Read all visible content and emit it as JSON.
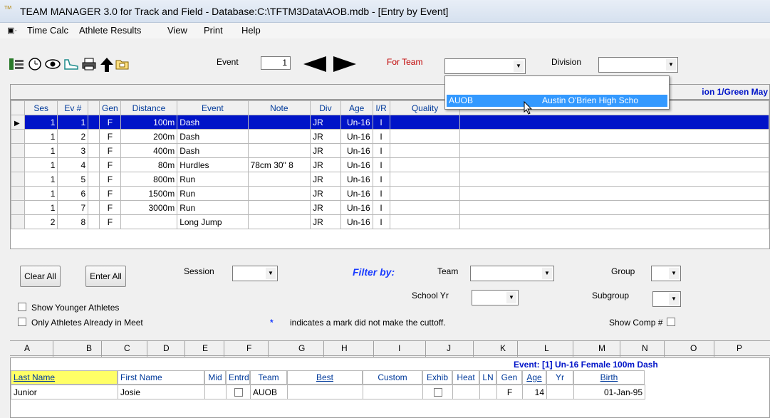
{
  "window": {
    "title": "TEAM MANAGER 3.0 for Track and Field - Database:C:\\TFTM3Data\\AOB.mdb - [Entry by Event]",
    "icon_text": "TM"
  },
  "menu": [
    "Time Calc",
    "Athlete Results",
    "View",
    "Print",
    "Help"
  ],
  "toolbar": {
    "event_label": "Event",
    "event_value": "1",
    "for_team_label": "For Team",
    "for_team_value": "",
    "division_label": "Division",
    "division_value": ""
  },
  "banner_text": "ion 1/Green May",
  "team_dropdown": {
    "code": "AUOB",
    "name": "Austin O'Brien High Scho"
  },
  "event_grid": {
    "headers": [
      "Ses",
      "Ev #",
      "Gen",
      "Distance",
      "Event",
      "Note",
      "Div",
      "Age",
      "I/R",
      "Quality"
    ],
    "rows": [
      [
        "1",
        "1",
        "F",
        "100m",
        "Dash",
        "",
        "JR",
        "Un-16",
        "I"
      ],
      [
        "1",
        "2",
        "F",
        "200m",
        "Dash",
        "",
        "JR",
        "Un-16",
        "I"
      ],
      [
        "1",
        "3",
        "F",
        "400m",
        "Dash",
        "",
        "JR",
        "Un-16",
        "I"
      ],
      [
        "1",
        "4",
        "F",
        "80m",
        "Hurdles",
        "78cm 30\" 8",
        "JR",
        "Un-16",
        "I"
      ],
      [
        "1",
        "5",
        "F",
        "800m",
        "Run",
        "",
        "JR",
        "Un-16",
        "I"
      ],
      [
        "1",
        "6",
        "F",
        "1500m",
        "Run",
        "",
        "JR",
        "Un-16",
        "I"
      ],
      [
        "1",
        "7",
        "F",
        "3000m",
        "Run",
        "",
        "JR",
        "Un-16",
        "I"
      ],
      [
        "2",
        "8",
        "F",
        "",
        "Long Jump",
        "",
        "JR",
        "Un-16",
        "I"
      ]
    ]
  },
  "filter": {
    "clear_all": "Clear All",
    "enter_all": "Enter All",
    "session_label": "Session",
    "filter_by": "Filter by:",
    "team_label": "Team",
    "school_yr_label": "School Yr",
    "group_label": "Group",
    "subgroup_label": "Subgroup",
    "show_younger": "Show Younger Athletes",
    "only_in_meet": "Only Athletes Already in Meet",
    "asterisk": "*",
    "note": "indicates a mark did not make the cuttoff.",
    "show_comp": "Show Comp #"
  },
  "column_letters": [
    "A",
    "B",
    "C",
    "D",
    "E",
    "F",
    "G",
    "H",
    "I",
    "J",
    "K",
    "L",
    "M",
    "N",
    "O",
    "P"
  ],
  "athlete_grid": {
    "event_header": "Event: [1]  Un-16  Female   100m  Dash",
    "headers": [
      "Last Name",
      "First Name",
      "Mid",
      "Entrd",
      "Team",
      "Best",
      "Custom",
      "Exhib",
      "Heat",
      "LN",
      "Gen",
      "Age",
      "Yr",
      "Birth"
    ],
    "rows": [
      {
        "last": "Junior",
        "first": "Josie",
        "mid": "",
        "team": "AUOB",
        "best": "",
        "custom": "",
        "heat": "",
        "ln": "",
        "gen": "F",
        "age": "14",
        "yr": "",
        "birth": "01-Jan-95"
      }
    ]
  },
  "colors": {
    "selection": "#0014c8",
    "dropdown_highlight": "#3399ff",
    "header_yellow": "#ffff66",
    "label_blue": "#003a9b",
    "red_label": "#c00000"
  }
}
